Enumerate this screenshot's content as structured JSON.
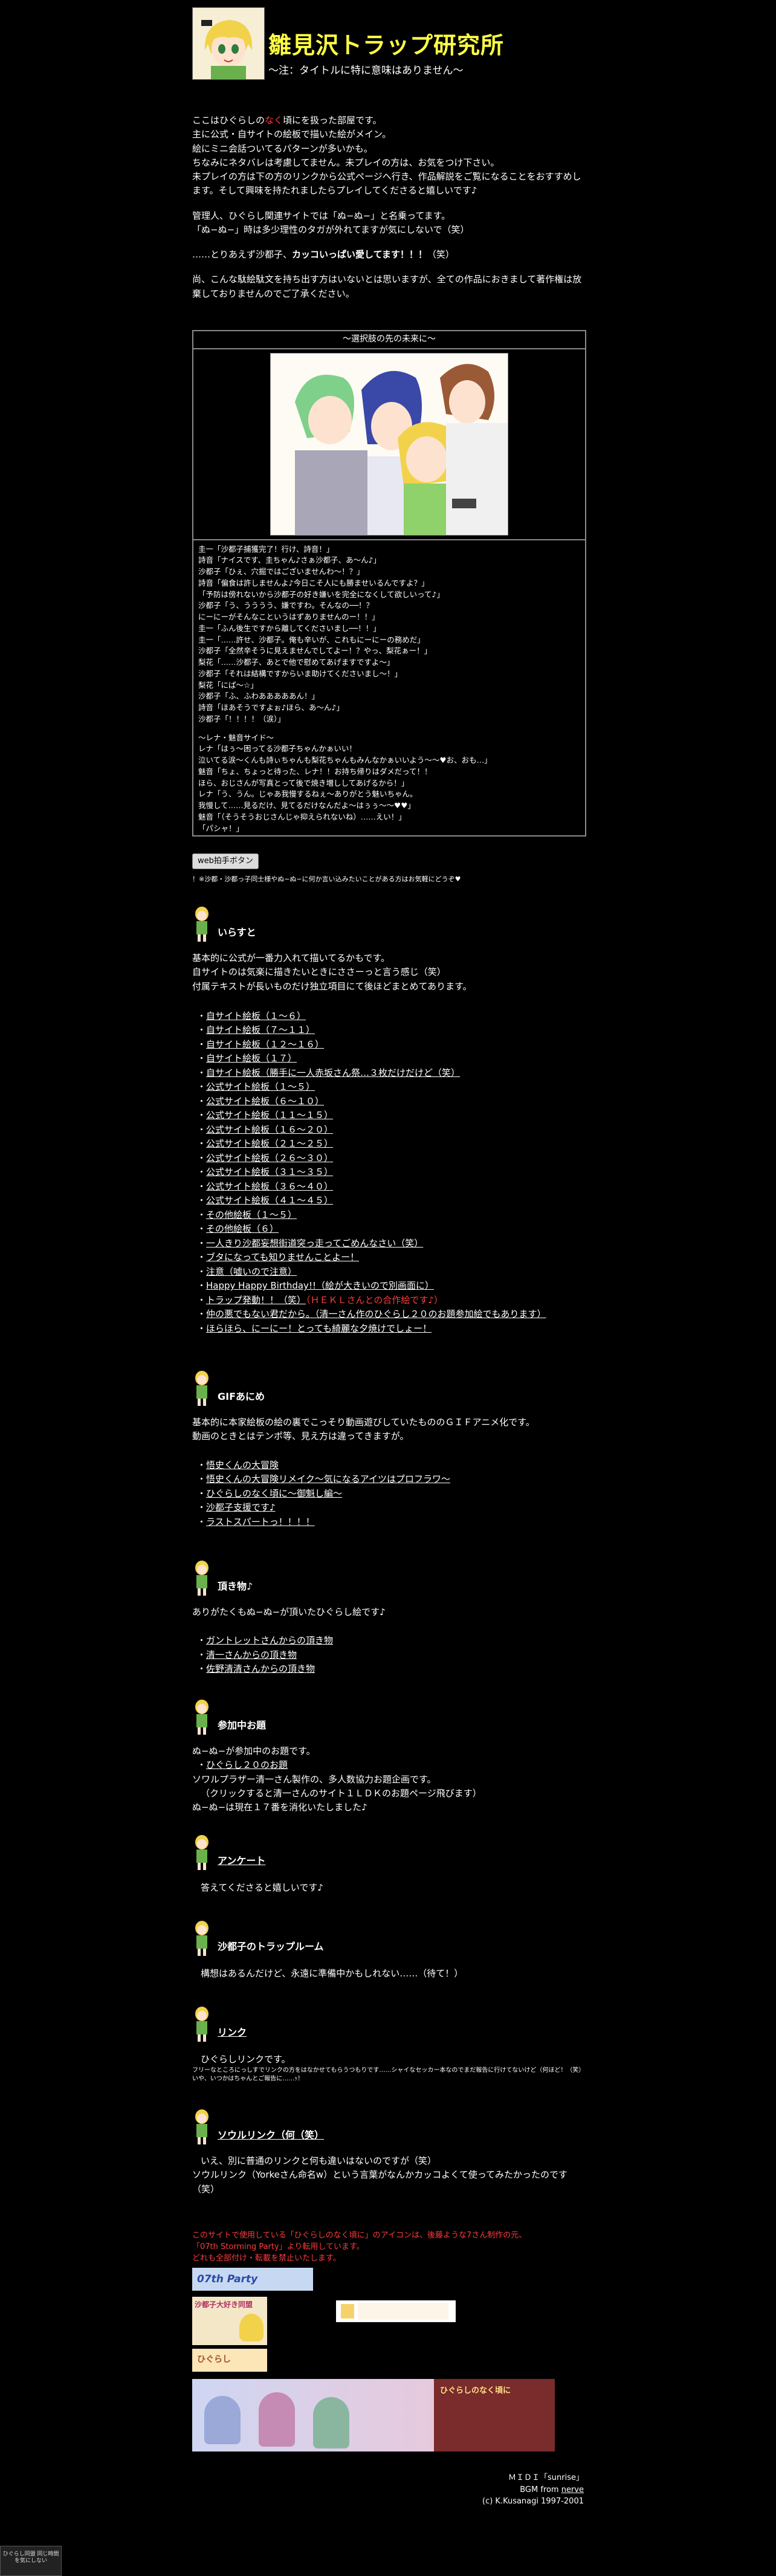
{
  "header": {
    "title": "雛見沢トラップ研究所",
    "subtitle": "〜注：タイトルに特に意味はありません〜"
  },
  "intro": {
    "p1_a": "ここはひぐらしの",
    "p1_red": "なく",
    "p1_b": "頃にを扱った部屋です。",
    "p1_l2": "主に公式・自サイトの絵板で描いた絵がメイン。",
    "p1_l3": "絵にミニ会話ついてるパターンが多いかも。",
    "p1_l4": "ちなみにネタバレは考慮してません。未プレイの方は、お気をつけ下さい。",
    "p1_l5": "未プレイの方は下の方のリンクから公式ページへ行き、作品解説をご覧になることをおすすめします。そして興味を持たれましたらプレイしてくださると嬉しいです♪",
    "p2_l1": "管理人、ひぐらし関連サイトでは「ぬ−ぬ−」と名乗ってます。",
    "p2_l2": "「ぬ−ぬ−」時は多少理性のタガが外れてますが気にしないで（笑）",
    "p3_a": "……とりあえず沙都子、",
    "p3_b": "カッコいっぱい愛してます！！！",
    "p3_c": "（笑）",
    "p4": "尚、こんな駄絵駄文を持ち出す方はいないとは思いますが、全ての作品におきまして著作権は放棄しておりませんのでご了承ください。"
  },
  "featured": {
    "title": "〜選択肢の先の未来に〜",
    "illustration_label": "イラスト",
    "lines_a": [
      "圭一「沙都子捕獲完了！行け、詩音！」",
      "詩音「ナイスです、圭ちゃん♪さぁ沙都子、あ〜ん♪」",
      "沙都子「ひぇ、穴掘ではございませんわ〜！？」",
      "詩音「偏食は許しませんよ♪今日こそ人にも勝ませいるんですよ？」",
      "「予防は傍れないから沙都子の好き嫌いを完全になくして欲しいって♪」",
      "沙都子「う、うううう、嫌ですわ。そんなの──！？",
      "にーにーがそんなこというはずありませんのー！！」",
      "圭一「ふん後生ですから離してくださいまし──！！」",
      "圭一「……許せ、沙都子。俺も辛いが、これもにーにーの務めだ」",
      "沙都子「全然辛そうに見えませんでしてよー！？やっ、梨花ぁー！」",
      "梨花「……沙都子、あとで他で慰めてあげますですよ〜」",
      "沙都子「それは結構ですからいま助けてくださいまし〜！」",
      "梨花「にぱ〜☆」",
      "沙都子「ふ、ふわあああああん！」",
      "詩音「ほあそうですよぉ♪ほら、あ〜ん♪」",
      "沙都子「！！！！（涙）」"
    ],
    "lines_b": [
      "〜レナ・魅音サイド〜",
      "レナ「はぅ〜困ってる沙都子ちゃんかぁいい！",
      "泣いてる涙〜くんも詩ぃちゃんも梨花ちゃんもみんなかぁいいよう〜〜♥お、おも…」",
      "魅音「ちょ、ちょっと待った、レナ！！お持ち帰りはダメだって！！",
      "ほら、おじさんが写真とって後で焼き増ししてあげるから！」",
      "レナ「う、うん。じゃあ我慢するねぇ〜ありがとう魅いちゃん。",
      "我慢して……見るだけ、見てるだけなんだよ〜はぅぅ〜〜♥♥」",
      "魅音「（そうそうおじさんじゃ抑えられないね）……えい！」",
      "「パシャ！」"
    ]
  },
  "web_clap": {
    "button_label": "web拍手ボタン",
    "note": "！※沙都・沙都っ子同士様やぬ−ぬ−に何か言い込みたいことがある方はお気軽にどうぞ♥"
  },
  "sections": {
    "irasuto": {
      "title": "いらすと",
      "desc_l1": "基本的に公式が一番力入れて描いてるかもです。",
      "desc_l2": "自サイトのは気楽に描きたいときにささーっと言う感じ（笑）",
      "desc_l3": "付属テキストが長いものだけ独立項目にて後ほどまとめてあります。",
      "links": [
        "自サイト絵板（１〜６）",
        "自サイト絵板（７〜１１）",
        "自サイト絵板（１２〜１６）",
        "自サイト絵板（１７）",
        "自サイト絵板（勝手に一人赤坂さん祭…３枚だけだけど（笑）",
        "公式サイト絵板（１〜５）",
        "公式サイト絵板（６〜１０）",
        "公式サイト絵板（１１〜１５）",
        "公式サイト絵板（１６〜２０）",
        "公式サイト絵板（２１〜２５）",
        "公式サイト絵板（２６〜３０）",
        "公式サイト絵板（３１〜３５）",
        "公式サイト絵板（３６〜４０）",
        "公式サイト絵板（４１〜４５）",
        "その他絵板（１〜５）",
        "その他絵板（６）",
        "一人きり沙都妄想街道突っ走ってごめんなさい（笑）",
        "ブタになっても知りませんことよー！",
        "注意（嘘いので注意）",
        "Happy Happy Birthday!!（絵が大きいので別画面に）"
      ],
      "trap_a": "トラップ発動！！（笑）",
      "trap_b": "（ＨＥＫＬさんとの合作絵です♪）",
      "links2": [
        "仲の悪でもない君だから。（清一さん作のひぐらし２０のお題参加絵でもあります）",
        "ほらほら、にーにー！とっても綺麗な夕焼けでしょー！"
      ]
    },
    "gif": {
      "title": "GIFあにめ",
      "desc_l1": "基本的に本家絵板の絵の裏でこっそり動画遊びしていたもののＧＩＦアニメ化です。",
      "desc_l2": "動画のときとはテンポ等、見え方は違ってきますが。",
      "links": [
        "悟史くんの大冒険",
        "悟史くんの大冒険リメイク〜気になるアイツはプロフラワ〜",
        "ひぐらしのなく頃に〜御魁し編〜",
        "沙都子支援です♪",
        "ラストスパートっ！！！！"
      ]
    },
    "itadaki": {
      "title": "頂き物♪",
      "desc": "ありがたくもぬ−ぬ−が頂いたひぐらし絵です♪",
      "links": [
        "ガントレットさんからの頂き物",
        "清一さんからの頂き物",
        "佐野清清さんからの頂き物"
      ]
    },
    "sanka": {
      "title": "参加中お題",
      "desc": "ぬ−ぬ−が参加中のお題です。",
      "link": "ひぐらし２０のお題",
      "l1": "ソワルプラザー清一さん製作の、多人数協力お題企画です。",
      "l2": "（クリックすると清一さんのサイト１ＬＤＫのお題ページ飛びます）",
      "l3": "ぬ−ぬ−は現在１７番を消化いたしました♪"
    },
    "enquete": {
      "title": "アンケート",
      "desc": "答えてくださると嬉しいです♪"
    },
    "trap_room": {
      "title": "沙都子のトラップルーム",
      "desc": "構想はあるんだけど、永遠に準備中かもしれない……（待て！）"
    },
    "link": {
      "title": "リンク",
      "desc": "ひぐらしリンクです。",
      "tiny_l1": "フリーなところにっしすでリンクの方をはなかせてもらうつもりです……シャイなセッカー本なのでまだ報告に行けてないけど（何ほど！（笑）",
      "tiny_l2": "いや、いつかはちゃんとご報告に……ｯ！"
    },
    "soul_link": {
      "title": "ソウルリンク（何（笑）",
      "l1": "いえ、別に普通のリンクと何も違いはないのですが（笑）",
      "l2": "ソウルリンク（Yorkeさん命名w）という言葉がなんかカッコよくて使ってみたかったのです（笑）"
    }
  },
  "credits": {
    "l1": "このサイトで使用している「ひぐらしのなく頃に」のアイコンは、後藤ような7さん制作の元、",
    "l2": "「07th Storming Party」より転用しています。",
    "l3": "どれも全部付け・転載を禁止いたします。"
  },
  "banners": {
    "b1": "07th Party",
    "b2": "沙都子大好き同盟",
    "b3": "",
    "b4": "ひぐらし",
    "b5_left": "",
    "b5_right": "ひぐらしのなく頃に"
  },
  "footer": {
    "l1": "ＭＩＤＩ「sunrise」",
    "l2a": "BGM from ",
    "l2b": "nerve",
    "l3": "(c) K.Kusanagi 1997-2001"
  },
  "corner_badge": "ひぐらし同盟 同じ時間を気にしない"
}
